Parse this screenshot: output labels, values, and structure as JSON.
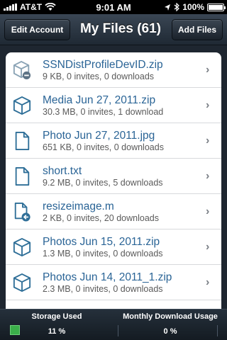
{
  "status_bar": {
    "carrier": "AT&T",
    "time": "9:01 AM",
    "battery": "100%",
    "battery_level": 1.0
  },
  "nav": {
    "left_button": "Edit Account",
    "title": "My Files (61)",
    "right_button": "Add Files"
  },
  "files": [
    {
      "name": "SSNDistProfileDevID.zip",
      "meta": "9 KB, 0 invites, 0 downloads",
      "icon": "zip-delete-icon"
    },
    {
      "name": "Media Jun 27, 2011.zip",
      "meta": "30.3 MB, 0 invites, 1 download",
      "icon": "zip-icon"
    },
    {
      "name": "Photo Jun 27, 2011.jpg",
      "meta": "651 KB, 0 invites, 0 downloads",
      "icon": "document-icon"
    },
    {
      "name": "short.txt",
      "meta": "9.2 MB, 0 invites, 5 downloads",
      "icon": "document-icon"
    },
    {
      "name": "resizeimage.m",
      "meta": "2 KB, 0 invites, 20 downloads",
      "icon": "document-upload-icon"
    },
    {
      "name": "Photos Jun 15, 2011.zip",
      "meta": "1.3 MB, 0 invites, 0 downloads",
      "icon": "zip-icon"
    },
    {
      "name": "Photos Jun 14, 2011_1.zip",
      "meta": "2.3 MB, 0 invites, 0 downloads",
      "icon": "zip-icon"
    }
  ],
  "footer": {
    "storage_label": "Storage Used",
    "storage_value": "11 %",
    "download_label": "Monthly Download Usage",
    "download_value": "0 %"
  },
  "colors": {
    "file_name": "#2a6496",
    "storage_indicator": "#3bb04a"
  }
}
